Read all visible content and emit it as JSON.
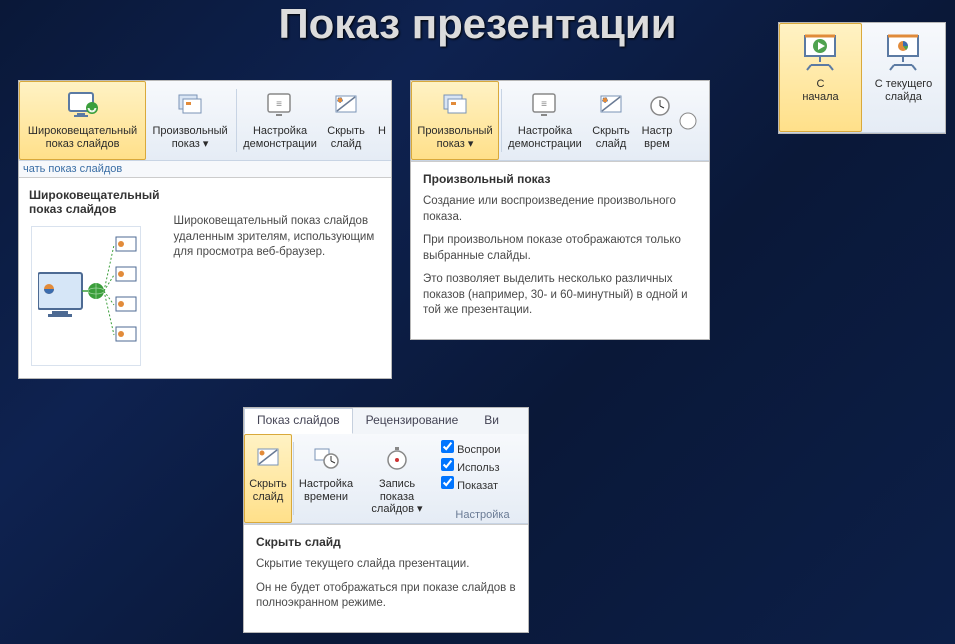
{
  "page_title": "Показ презентации",
  "panel1": {
    "buttons": {
      "broadcast": "Широковещательный\nпоказ слайдов",
      "custom": "Произвольный\nпоказ ▾",
      "setup": "Настройка\nдемонстрации",
      "hide": "Скрыть\nслайд",
      "trunc": "Н"
    },
    "footer": "чать показ слайдов",
    "tooltip_title": "Широковещательный показ слайдов",
    "tooltip_body": "Широковещательный показ слайдов удаленным зрителям, использующим для просмотра веб-браузер."
  },
  "panel2": {
    "buttons": {
      "custom": "Произвольный\nпоказ ▾",
      "setup": "Настройка\nдемонстрации",
      "hide": "Скрыть\nслайд",
      "trunc": "Настр\nврем"
    },
    "tooltip_title": "Произвольный показ",
    "tooltip_p1": "Создание или воспроизведение произвольного показа.",
    "tooltip_p2": "При произвольном показе отображаются только выбранные слайды.",
    "tooltip_p3": "Это позволяет выделить несколько различных показов (например, 30- и 60-минутный) в одной и той же презентации."
  },
  "panel3": {
    "from_start": "С\nначала",
    "from_current": "С текущего\nслайда"
  },
  "panel4": {
    "tabs": {
      "show": "Показ слайдов",
      "review": "Рецензирование",
      "view_trunc": "Ви"
    },
    "buttons": {
      "hide": "Скрыть\nслайд",
      "rehearse": "Настройка\nвремени",
      "record": "Запись показа\nслайдов ▾"
    },
    "opts": {
      "o1": "Воспрои",
      "o2": "Использ",
      "o3": "Показат"
    },
    "group": "Настройка",
    "tooltip_title": "Скрыть слайд",
    "tooltip_p1": "Скрытие текущего слайда презентации.",
    "tooltip_p2": "Он не будет отображаться при показе слайдов в полноэкранном режиме."
  }
}
